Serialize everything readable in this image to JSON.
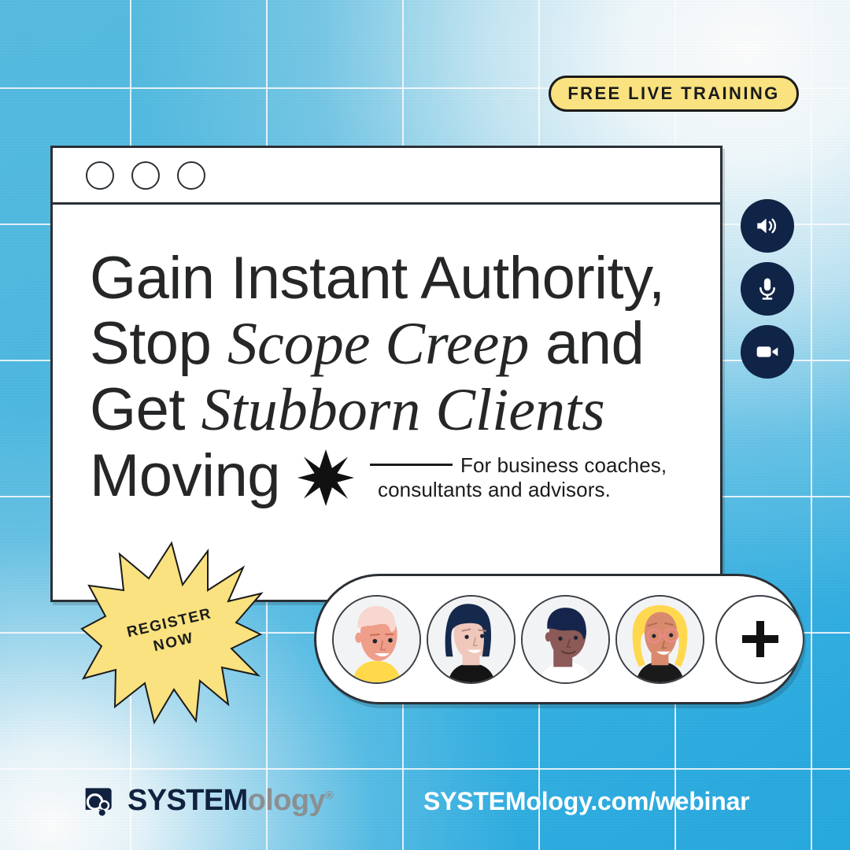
{
  "badge": {
    "label": "FREE LIVE TRAINING"
  },
  "window": {
    "dots": [
      "dot-1",
      "dot-2",
      "dot-3"
    ],
    "headline": {
      "line1": "Gain Instant Authority,",
      "line2_a": "Stop ",
      "line2_em": "Scope Creep",
      "line2_b": " and",
      "line3_a": "Get ",
      "line3_em": "Stubborn Clients",
      "line4": "Moving"
    },
    "subtext": {
      "line1": "For business coaches,",
      "line2": "consultants and advisors."
    }
  },
  "controls": [
    {
      "name": "speaker-icon",
      "label": "speaker"
    },
    {
      "name": "microphone-icon",
      "label": "microphone"
    },
    {
      "name": "video-camera-icon",
      "label": "video camera"
    }
  ],
  "starburst": {
    "line1": "REGISTER",
    "line2": "NOW",
    "fill": "#f9e27f"
  },
  "avatars": [
    {
      "name": "avatar-person-1",
      "hair": "#f4cfc8",
      "skin": "#ef9e8a",
      "shirt": "#ffd94a"
    },
    {
      "name": "avatar-person-2",
      "hair": "#15294d",
      "skin": "#f0c7bb",
      "shirt": "#141414"
    },
    {
      "name": "avatar-person-3",
      "hair": "#16254b",
      "skin": "#8c5a57",
      "shirt": "#ffffff"
    },
    {
      "name": "avatar-person-4",
      "hair": "#ffd84f",
      "skin": "#d98a6d",
      "shirt": "#1a1a1a"
    }
  ],
  "add_button": {
    "label": "+"
  },
  "footer": {
    "logo_sys": "SYSTEM",
    "logo_ology": "ology",
    "logo_reg": "®",
    "url": "SYSTEMology.com/webinar"
  },
  "colors": {
    "background_blue": "#4ab8e2",
    "badge_yellow": "#f9e27f",
    "ink": "#2b3036",
    "navy": "#0f2447"
  }
}
